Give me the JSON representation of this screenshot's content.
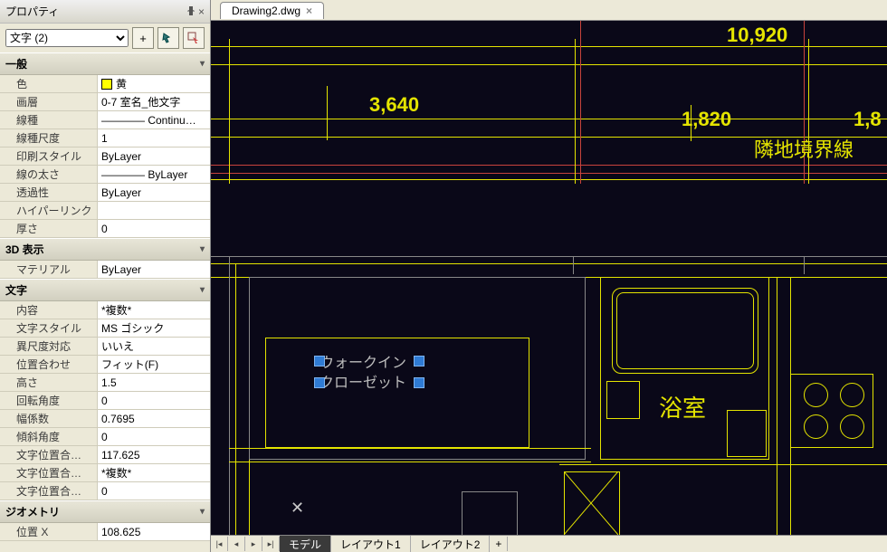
{
  "panel": {
    "title": "プロパティ",
    "selector": "文字 (2)",
    "sections": {
      "general": "一般",
      "view3d": "3D 表示",
      "text": "文字",
      "geometry": "ジオメトリ"
    },
    "props": {
      "color_label": "色",
      "color_value": "黄",
      "layer_label": "画層",
      "layer_value": "0-7 室名_他文字",
      "linetype_label": "線種",
      "linetype_value": "———— Continu…",
      "ltscale_label": "線種尺度",
      "ltscale_value": "1",
      "plotstyle_label": "印刷スタイル",
      "plotstyle_value": "ByLayer",
      "lineweight_label": "線の太さ",
      "lineweight_value": "———— ByLayer",
      "transparency_label": "透過性",
      "transparency_value": "ByLayer",
      "hyperlink_label": "ハイパーリンク",
      "hyperlink_value": "",
      "thickness_label": "厚さ",
      "thickness_value": "0",
      "material_label": "マテリアル",
      "material_value": "ByLayer",
      "contents_label": "内容",
      "contents_value": "*複数*",
      "style_label": "文字スタイル",
      "style_value": "MS ゴシック",
      "annotative_label": "異尺度対応",
      "annotative_value": "いいえ",
      "justify_label": "位置合わせ",
      "justify_value": "フィット(F)",
      "height_label": "高さ",
      "height_value": "1.5",
      "rotation_label": "回転角度",
      "rotation_value": "0",
      "widthfactor_label": "幅係数",
      "widthfactor_value": "0.7695",
      "oblique_label": "傾斜角度",
      "oblique_value": "0",
      "alignx_label": "文字位置合…",
      "alignx_value": "117.625",
      "aligny_label": "文字位置合…",
      "aligny_value": "*複数*",
      "alignz_label": "文字位置合…",
      "alignz_value": "0",
      "posx_label": "位置 X",
      "posx_value": "108.625"
    }
  },
  "doc": {
    "tab": "Drawing2.dwg",
    "layouts": {
      "model": "モデル",
      "layout1": "レイアウト1",
      "layout2": "レイアウト2"
    }
  },
  "drawing": {
    "dim_10920": "10,920",
    "dim_3640": "3,640",
    "dim_1820": "1,820",
    "dim_1r": "1,8",
    "boundary": "隣地境界線",
    "bath": "浴室",
    "closet1": "ウォークイン",
    "closet2": "クローゼット"
  }
}
